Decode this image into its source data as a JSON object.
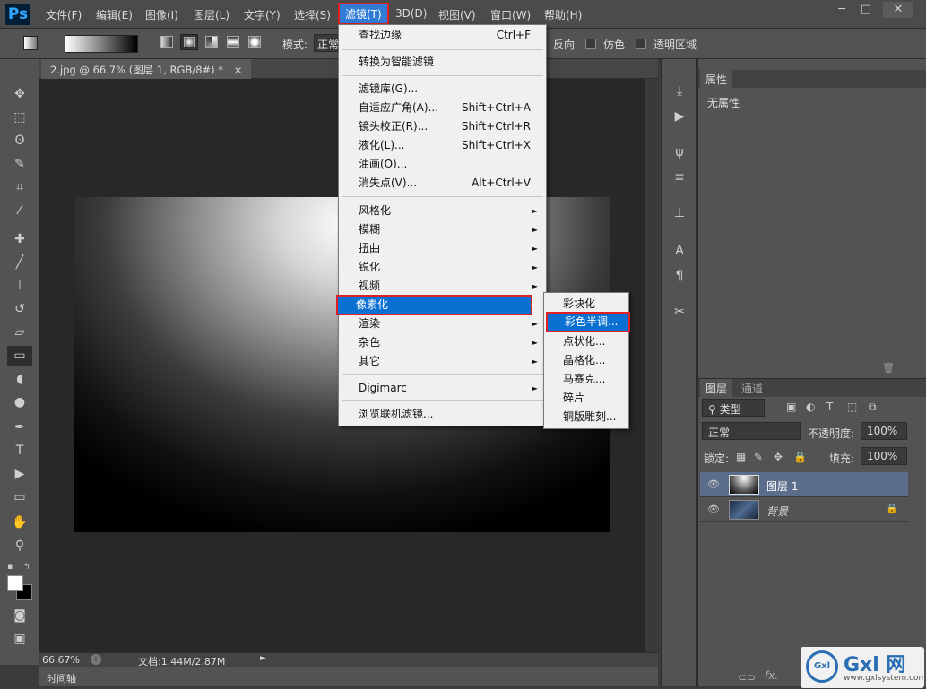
{
  "app": {
    "logo": "Ps"
  },
  "menubar": {
    "items": [
      "文件(F)",
      "编辑(E)",
      "图像(I)",
      "图层(L)",
      "文字(Y)",
      "选择(S)",
      "滤镜(T)",
      "3D(D)",
      "视图(V)",
      "窗口(W)",
      "帮助(H)"
    ],
    "active_index": 6
  },
  "window_controls": [
    "─",
    "□",
    "✕"
  ],
  "options": {
    "mode_label": "模式:",
    "mode_value": "正常",
    "reverse_label": "反向",
    "dither_label": "仿色",
    "transparency_label": "透明区域"
  },
  "document": {
    "tab_title": "2.jpg @ 66.7% (图层 1, RGB/8#) *",
    "tab_close": "×"
  },
  "status": {
    "zoom": "66.67%",
    "doc_info": "文档:1.44M/2.87M"
  },
  "timeline": {
    "label": "时间轴"
  },
  "filter_menu": {
    "items": [
      {
        "label": "查找边缘",
        "shortcut": "Ctrl+F"
      },
      {
        "label": "转换为智能滤镜"
      },
      {
        "label": "滤镜库(G)..."
      },
      {
        "label": "自适应广角(A)...",
        "shortcut": "Shift+Ctrl+A"
      },
      {
        "label": "镜头校正(R)...",
        "shortcut": "Shift+Ctrl+R"
      },
      {
        "label": "液化(L)...",
        "shortcut": "Shift+Ctrl+X"
      },
      {
        "label": "油画(O)..."
      },
      {
        "label": "消失点(V)...",
        "shortcut": "Alt+Ctrl+V"
      },
      {
        "label": "风格化"
      },
      {
        "label": "模糊"
      },
      {
        "label": "扭曲"
      },
      {
        "label": "锐化"
      },
      {
        "label": "视频"
      },
      {
        "label": "像素化"
      },
      {
        "label": "渲染"
      },
      {
        "label": "杂色"
      },
      {
        "label": "其它"
      },
      {
        "label": "Digimarc"
      },
      {
        "label": "浏览联机滤镜..."
      }
    ],
    "submenu_arrow": "►"
  },
  "pixelate_submenu": {
    "items": [
      "彩块化",
      "彩色半调...",
      "点状化...",
      "晶格化...",
      "马赛克...",
      "碎片",
      "铜版雕刻..."
    ],
    "highlighted_index": 1
  },
  "properties": {
    "tab": "属性",
    "empty_text": "无属性"
  },
  "layers_panel": {
    "tabs": [
      "图层",
      "通道"
    ],
    "filter_kind": "类型",
    "blend_mode": "正常",
    "opacity_label": "不透明度:",
    "opacity_value": "100%",
    "lock_label": "锁定:",
    "fill_label": "填充:",
    "fill_value": "100%",
    "layers": [
      {
        "name": "图层 1",
        "selected": true
      },
      {
        "name": "背景",
        "locked": true
      }
    ]
  },
  "watermark": {
    "text": "Gxl 网",
    "url": "www.gxlsystem.com"
  },
  "colors": {
    "accent": "#0a70d2",
    "highlight_border": "#e02020",
    "ps_blue": "#31a8ff"
  }
}
